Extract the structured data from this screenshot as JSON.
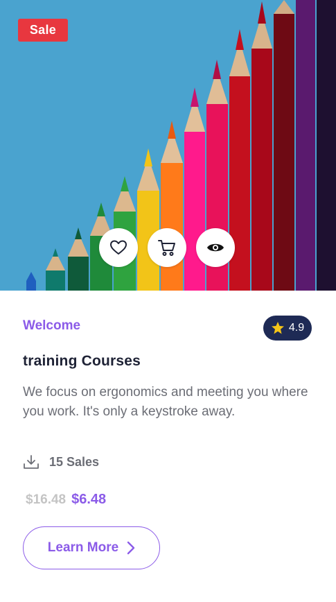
{
  "badge": {
    "label": "Sale",
    "color": "#e8373f"
  },
  "actions": [
    {
      "icon": "heart-icon"
    },
    {
      "icon": "cart-icon"
    },
    {
      "icon": "eye-icon"
    }
  ],
  "course": {
    "category": "Welcome",
    "rating": "4.9",
    "title": "training Courses",
    "description": "We focus on ergonomics and meeting you where you work. It's only a keystroke away.",
    "sales": "15 Sales",
    "old_price": "$16.48",
    "new_price": "$6.48"
  },
  "cta": {
    "label": "Learn More"
  },
  "colors": {
    "accent": "#8b5be8",
    "rating_bg": "#1e2a55",
    "star": "#f5c518",
    "sky": "#4aa3cf"
  }
}
